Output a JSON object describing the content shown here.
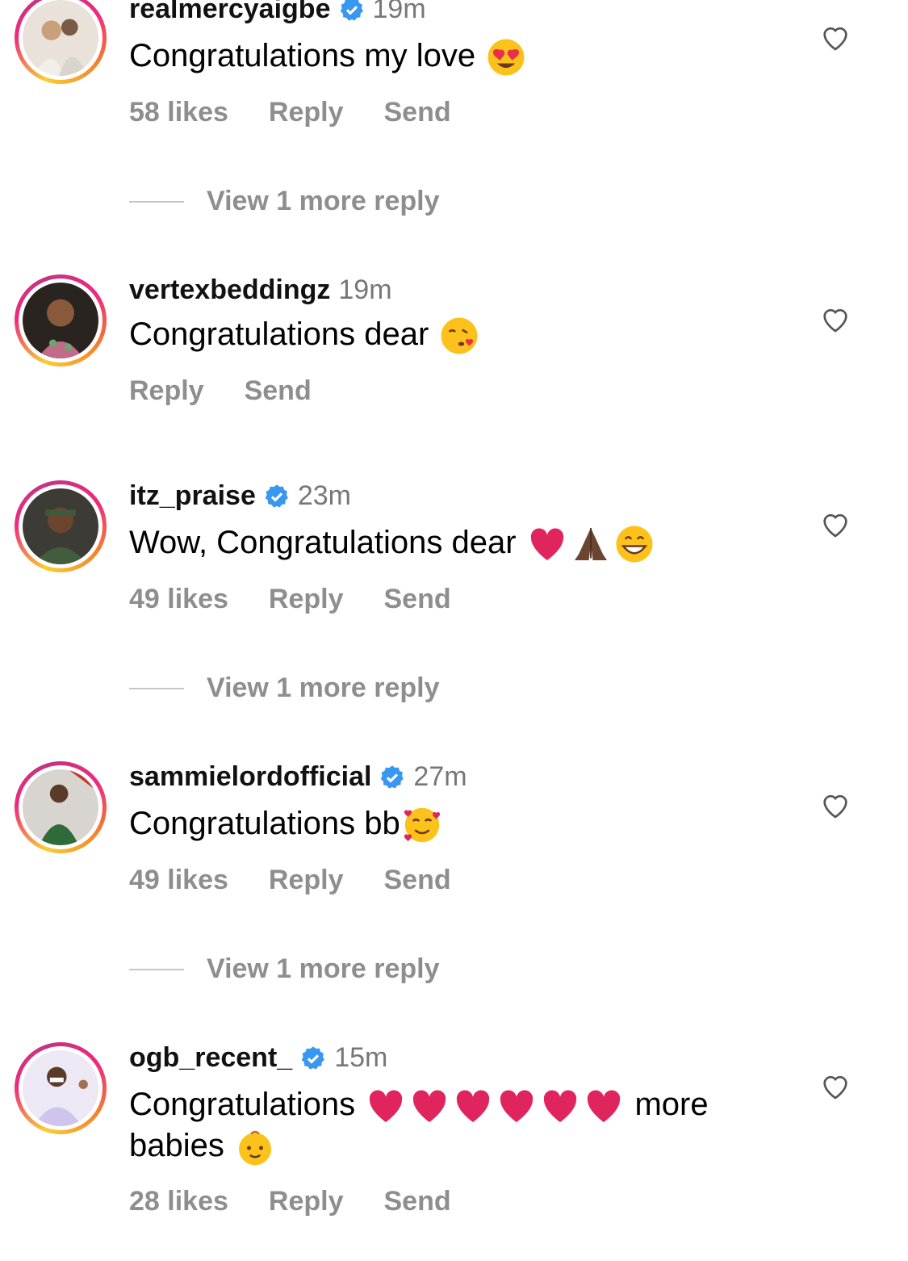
{
  "comments": [
    {
      "username": "realmercyaigbe",
      "verified": true,
      "time": "19m",
      "text": "Congratulations my love",
      "emojis": [
        "heart-eyes-emoji"
      ],
      "likes": "58 likes",
      "reply": "Reply",
      "send": "Send",
      "view_more": "View 1 more reply"
    },
    {
      "username": "vertexbeddingz",
      "verified": false,
      "time": "19m",
      "text": "Congratulations dear",
      "emojis": [
        "kissing-heart-emoji"
      ],
      "reply": "Reply",
      "send": "Send"
    },
    {
      "username": "itz_praise",
      "verified": true,
      "time": "23m",
      "text": "Wow, Congratulations dear",
      "emojis": [
        "red-heart-emoji",
        "folded-hands-emoji",
        "grinning-emoji"
      ],
      "likes": "49 likes",
      "reply": "Reply",
      "send": "Send",
      "view_more": "View 1 more reply"
    },
    {
      "username": "sammielordofficial",
      "verified": true,
      "time": "27m",
      "text": "Congratulations bb",
      "emojis": [
        "smiling-hearts-emoji"
      ],
      "likes": "49 likes",
      "reply": "Reply",
      "send": "Send",
      "view_more": "View 1 more reply"
    },
    {
      "username": "ogb_recent_",
      "verified": true,
      "time": "15m",
      "text_part1": "Congratulations",
      "text_part2": "more",
      "text_part3": "babies",
      "emojis": [
        "red-heart-emoji",
        "red-heart-emoji",
        "red-heart-emoji",
        "red-heart-emoji",
        "red-heart-emoji",
        "red-heart-emoji",
        "baby-emoji"
      ],
      "likes": "28 likes",
      "reply": "Reply",
      "send": "Send"
    }
  ],
  "colors": {
    "muted": "#8e8e8e",
    "verified_blue": "#3897f0",
    "heart_red": "#e0245e"
  }
}
